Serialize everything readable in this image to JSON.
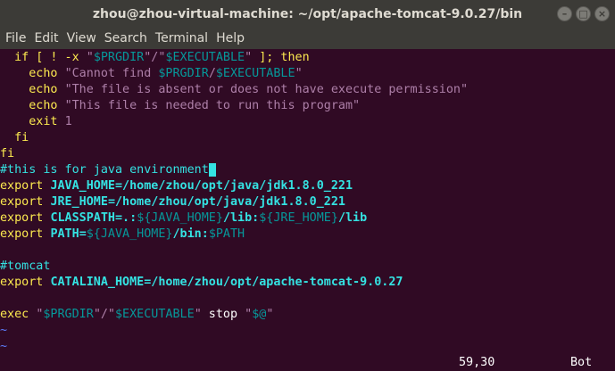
{
  "window": {
    "title": "zhou@zhou-virtual-machine: ~/opt/apache-tomcat-9.0.27/bin",
    "controls": {
      "minimize": "–",
      "maximize": "□",
      "close": "×"
    }
  },
  "menu": [
    {
      "label": "File",
      "name": "menu-file"
    },
    {
      "label": "Edit",
      "name": "menu-edit"
    },
    {
      "label": "View",
      "name": "menu-view"
    },
    {
      "label": "Search",
      "name": "menu-search"
    },
    {
      "label": "Terminal",
      "name": "menu-terminal"
    },
    {
      "label": "Help",
      "name": "menu-help"
    }
  ],
  "colors": {
    "background": "#300a24",
    "chrome": "#3c3b37",
    "keyword": "#fce94f",
    "string": "#ad7fa8",
    "variable": "#06989a",
    "comment": "#34e2e2"
  },
  "lines": [
    [
      [
        "  ",
        "plain"
      ],
      [
        "if [ ! -x ",
        "kw"
      ],
      [
        "\"",
        "str"
      ],
      [
        "$PRGDIR",
        "var"
      ],
      [
        "\"/\"",
        "str"
      ],
      [
        "$EXECUTABLE",
        "var"
      ],
      [
        "\"",
        "str"
      ],
      [
        " ]; then",
        "kw"
      ]
    ],
    [
      [
        "    ",
        "plain"
      ],
      [
        "echo ",
        "kw"
      ],
      [
        "\"Cannot find ",
        "str"
      ],
      [
        "$PRGDIR",
        "var"
      ],
      [
        "/",
        "str"
      ],
      [
        "$EXECUTABLE",
        "var"
      ],
      [
        "\"",
        "str"
      ]
    ],
    [
      [
        "    ",
        "plain"
      ],
      [
        "echo ",
        "kw"
      ],
      [
        "\"The file is absent or does not have execute permission\"",
        "str"
      ]
    ],
    [
      [
        "    ",
        "plain"
      ],
      [
        "echo ",
        "kw"
      ],
      [
        "\"This file is needed to run this program\"",
        "str"
      ]
    ],
    [
      [
        "    ",
        "plain"
      ],
      [
        "exit ",
        "kw"
      ],
      [
        "1",
        "str"
      ]
    ],
    [
      [
        "  ",
        "plain"
      ],
      [
        "fi",
        "kw"
      ]
    ],
    [
      [
        "fi",
        "kw"
      ]
    ],
    [
      [
        "#this is for java environment",
        "cmt"
      ],
      [
        " ",
        "cursor"
      ]
    ],
    [
      [
        "export ",
        "exp"
      ],
      [
        "JAVA_HOME",
        "name"
      ],
      [
        "=/home/zhou/opt/java/jdk1.8.0_221",
        "val"
      ]
    ],
    [
      [
        "export ",
        "exp"
      ],
      [
        "JRE_HOME",
        "name"
      ],
      [
        "=/home/zhou/opt/java/jdk1.8.0_221",
        "val"
      ]
    ],
    [
      [
        "export ",
        "exp"
      ],
      [
        "CLASSPATH",
        "name"
      ],
      [
        "=.:",
        "val"
      ],
      [
        "${JAVA_HOME}",
        "var"
      ],
      [
        "/lib:",
        "val"
      ],
      [
        "${JRE_HOME}",
        "var"
      ],
      [
        "/lib",
        "val"
      ]
    ],
    [
      [
        "export ",
        "exp"
      ],
      [
        "PATH",
        "name"
      ],
      [
        "=",
        "val"
      ],
      [
        "${JAVA_HOME}",
        "var"
      ],
      [
        "/bin:",
        "val"
      ],
      [
        "$PATH",
        "var"
      ]
    ],
    [],
    [
      [
        "#tomcat",
        "cmt"
      ]
    ],
    [
      [
        "export ",
        "exp"
      ],
      [
        "CATALINA_HOME",
        "name"
      ],
      [
        "=/home/zhou/opt/apache-tomcat-9.0.27",
        "val"
      ]
    ],
    [],
    [
      [
        "exec ",
        "kw"
      ],
      [
        "\"",
        "str"
      ],
      [
        "$PRGDIR",
        "var"
      ],
      [
        "\"/\"",
        "str"
      ],
      [
        "$EXECUTABLE",
        "var"
      ],
      [
        "\"",
        "str"
      ],
      [
        " stop ",
        "plain"
      ],
      [
        "\"",
        "str"
      ],
      [
        "$@",
        "var"
      ],
      [
        "\"",
        "str"
      ]
    ],
    [
      [
        "~",
        "tilde"
      ]
    ],
    [
      [
        "~",
        "tilde"
      ]
    ]
  ],
  "status": {
    "position": "59,30",
    "scroll": "Bot"
  }
}
